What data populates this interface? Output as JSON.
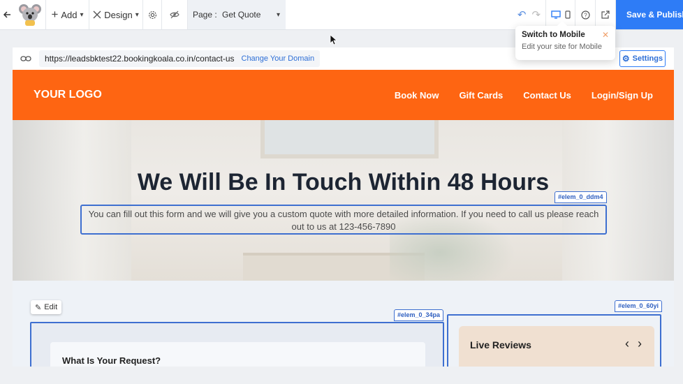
{
  "toolbar": {
    "add_label": "Add",
    "design_label": "Design",
    "page_prefix": "Page :",
    "page_value": "Get Quote",
    "save_label": "Save & Publish"
  },
  "tooltip": {
    "title": "Switch to Mobile",
    "text": "Edit your site for Mobile"
  },
  "urlbar": {
    "url": "https://leadsbktest22.bookingkoala.co.in/contact-us",
    "change_domain": "Change Your Domain",
    "settings_label": "Settings"
  },
  "site": {
    "logo": "YOUR LOGO",
    "nav": [
      "Book Now",
      "Gift Cards",
      "Contact Us",
      "Login/Sign Up"
    ],
    "hero_title": "We Will Be In Touch Within 48 Hours",
    "hero_subtitle": "You can fill out this form and we will give you a custom quote with more detailed information. If you need to call us please reach out to us at 123-456-7890"
  },
  "tags": {
    "hero_sub": "#elem_0_ddm4",
    "form": "#elem_0_34pa",
    "reviews": "#elem_0_60yi"
  },
  "content": {
    "edit_label": "Edit",
    "form_question": "What Is Your Request?",
    "reviews_title": "Live Reviews"
  },
  "colors": {
    "brand_orange": "#fe6512",
    "accent_blue": "#2e7cf6",
    "selection_blue": "#3e6fd0"
  }
}
